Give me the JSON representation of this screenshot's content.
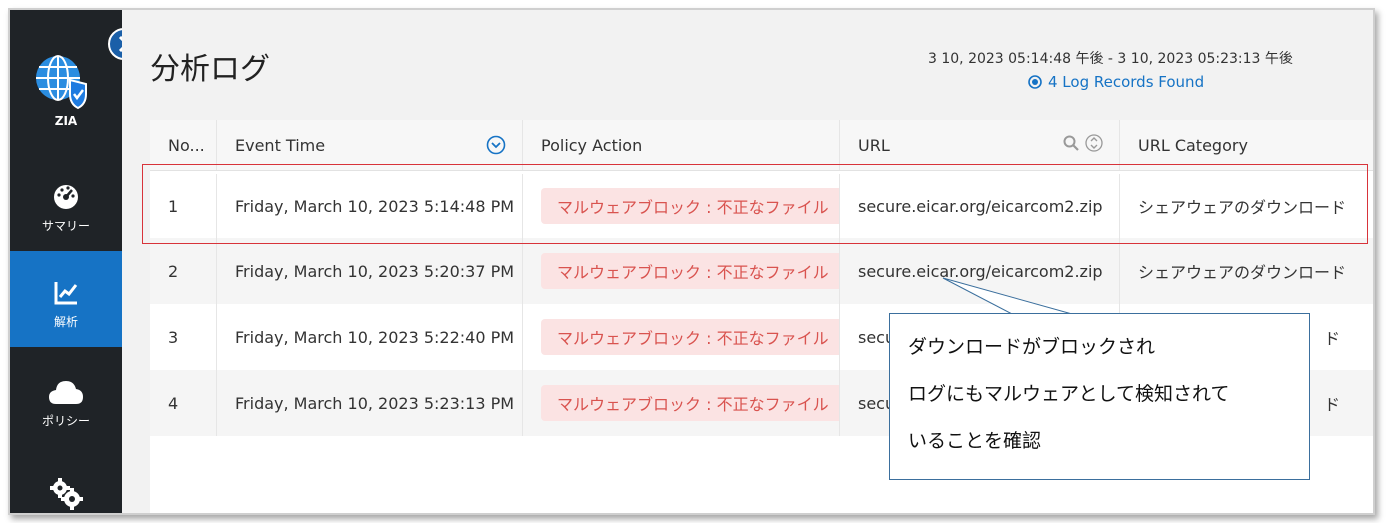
{
  "sidebar": {
    "brand": "ZIA",
    "items": [
      {
        "label": "サマリー",
        "icon": "dashboard-gauge-icon"
      },
      {
        "label": "解析",
        "icon": "analytics-chart-icon",
        "active": true
      },
      {
        "label": "ポリシー",
        "icon": "cloud-icon"
      },
      {
        "label": "",
        "icon": "settings-gears-icon"
      }
    ]
  },
  "header": {
    "title": "分析ログ",
    "date_range": "3 10, 2023 05:14:48 午後 - 3 10, 2023 05:23:13 午後",
    "records_found": "4 Log Records Found"
  },
  "table": {
    "columns": [
      "No...",
      "Event Time",
      "Policy Action",
      "URL",
      "URL Category"
    ],
    "rows": [
      {
        "no": "1",
        "time": "Friday, March 10, 2023 5:14:48 PM",
        "action": "マルウェアブロック : 不正なファイル",
        "url": "secure.eicar.org/eicarcom2.zip",
        "category": "シェアウェアのダウンロード"
      },
      {
        "no": "2",
        "time": "Friday, March 10, 2023 5:20:37 PM",
        "action": "マルウェアブロック : 不正なファイル",
        "url": "secure.eicar.org/eicarcom2.zip",
        "category": "シェアウェアのダウンロード"
      },
      {
        "no": "3",
        "time": "Friday, March 10, 2023 5:22:40 PM",
        "action": "マルウェアブロック : 不正なファイル",
        "url": "secu",
        "category": "ド"
      },
      {
        "no": "4",
        "time": "Friday, March 10, 2023 5:23:13 PM",
        "action": "マルウェアブロック : 不正なファイル",
        "url": "secu",
        "category": "ド"
      }
    ]
  },
  "callout": {
    "lines": [
      "ダウンロードがブロックされ",
      "ログにもマルウェアとして検知されて",
      "いることを確認"
    ]
  },
  "colors": {
    "sidebar_bg": "#1f2327",
    "accent": "#1673c5",
    "badge_bg": "#fbe3e3",
    "badge_text": "#d9534f",
    "highlight": "#d8333a"
  }
}
